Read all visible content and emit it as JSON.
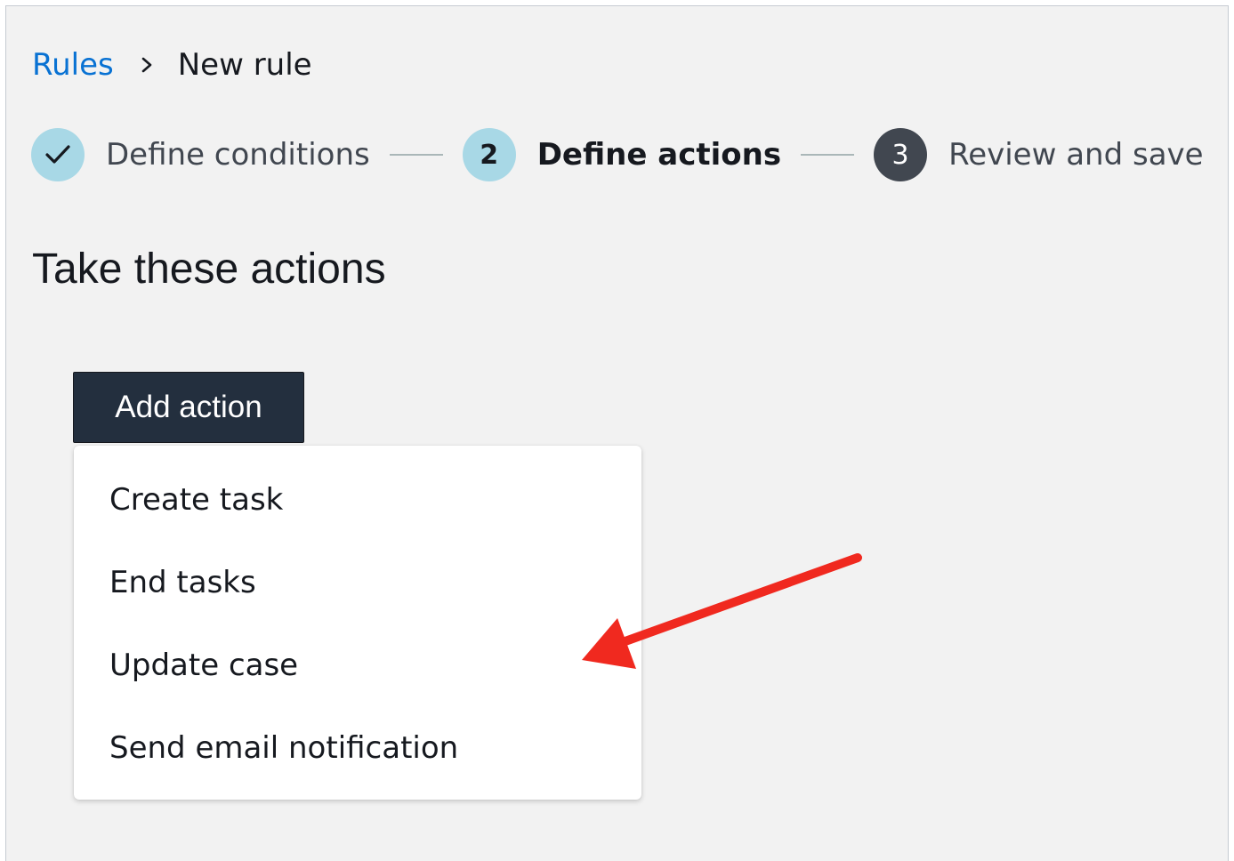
{
  "breadcrumb": {
    "parent_label": "Rules",
    "current_label": "New rule"
  },
  "steps": [
    {
      "number": "",
      "label": "Define conditions",
      "status": "completed"
    },
    {
      "number": "2",
      "label": "Define actions",
      "status": "active"
    },
    {
      "number": "3",
      "label": "Review and save",
      "status": "pending"
    }
  ],
  "main": {
    "heading": "Take these actions",
    "add_action_label": "Add action"
  },
  "dropdown": {
    "items": [
      {
        "label": "Create task"
      },
      {
        "label": "End tasks"
      },
      {
        "label": "Update case"
      },
      {
        "label": "Send email notification"
      }
    ]
  },
  "annotation": {
    "arrow_color": "#f0291f",
    "points_to": "Update case"
  },
  "colors": {
    "link": "#0972d3",
    "step_circle": "#a8d8e6",
    "step_pending_circle": "#414750",
    "button_primary": "#232f3e",
    "background": "#f2f2f2"
  }
}
